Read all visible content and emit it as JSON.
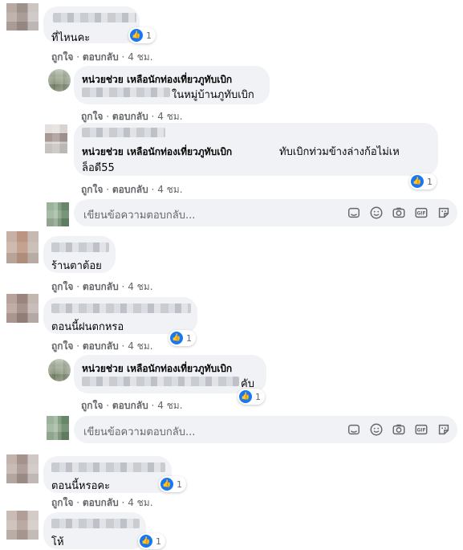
{
  "comments": [
    {
      "text": "ที่ไหนคะ",
      "likes": "1"
    },
    {
      "reply_name": "หน่วยช่วย เหลือนักท่องเที่ยวภูทับเบิก",
      "reply_text": "ในหมู่บ้านภูทับเบิก"
    },
    {
      "reply_name": "หน่วยช่วย เหลือนักท่องเที่ยวภูทับเบิก",
      "reply_text_1": "ทับเบิกท่วมข้างล่างก้อไม่เห",
      "reply_text_2": "ล็อดี55",
      "likes": "1"
    },
    {
      "text": "ร้านตาต้อย"
    },
    {
      "text": "ตอนนี้ฝนตกหรอ",
      "likes": "1"
    },
    {
      "reply_name": "หน่วยช่วย เหลือนักท่องเที่ยวภูทับเบิก",
      "reply_text": "คับ",
      "likes": "1"
    },
    {
      "text": "ตอนนี้หรอคะ",
      "likes": "1"
    },
    {
      "text": "โห้",
      "likes": "1"
    }
  ],
  "actions": {
    "like": "ถูกใจ",
    "reply": "ตอบกลับ",
    "time": "4 ชม."
  },
  "reply_input": {
    "placeholder": "เขียนข้อความตอบกลับ..."
  },
  "icons": [
    "emoji-icon",
    "smile-icon",
    "camera-icon",
    "gif-icon",
    "sticker-icon"
  ],
  "colors": {
    "accent": "#1877f2",
    "bubble": "#f0f2f5",
    "meta": "#65676b"
  }
}
